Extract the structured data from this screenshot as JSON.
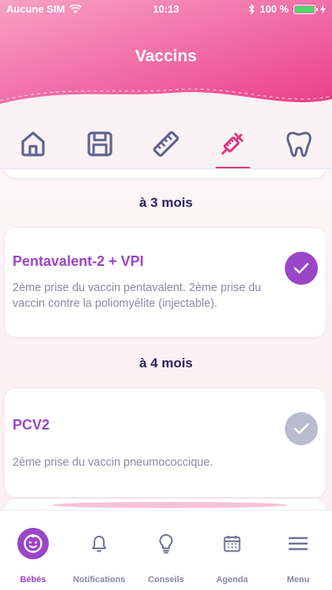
{
  "status_bar": {
    "carrier": "Aucune SIM",
    "time": "10:13",
    "battery": "100 %"
  },
  "header": {
    "title": "Vaccins"
  },
  "tabs": [
    {
      "icon": "home-icon",
      "active": false
    },
    {
      "icon": "save-disk-icon",
      "active": false
    },
    {
      "icon": "ruler-icon",
      "active": false
    },
    {
      "icon": "syringe-icon",
      "active": true
    },
    {
      "icon": "tooth-icon",
      "active": false
    }
  ],
  "sections": [
    {
      "title": "à 3 mois",
      "vaccine": {
        "name": "Pentavalent-2 + VPI",
        "description": "2ème prise du vaccin pentavalent. 2ème prise du vaccin contre la poliomyélite (injectable).",
        "done": true
      }
    },
    {
      "title": "à 4 mois",
      "vaccine": {
        "name": "PCV2",
        "description": "2ème prise du vaccin pneumococcique.",
        "done": false
      }
    }
  ],
  "bottom_nav": [
    {
      "label": "Bébés",
      "icon": "baby-face-icon",
      "active": true
    },
    {
      "label": "Notifications",
      "icon": "bell-icon",
      "active": false
    },
    {
      "label": "Conseils",
      "icon": "lightbulb-icon",
      "active": false
    },
    {
      "label": "Agenda",
      "icon": "calendar-icon",
      "active": false
    },
    {
      "label": "Menu",
      "icon": "menu-icon",
      "active": false
    }
  ],
  "colors": {
    "header_pink": "#ee4f93",
    "header_light": "#f8a1c4",
    "accent_purple": "#9b45c9",
    "active_tab": "#e0387c",
    "icon_gray": "#5f6390",
    "check_pending": "#b9bccf"
  }
}
